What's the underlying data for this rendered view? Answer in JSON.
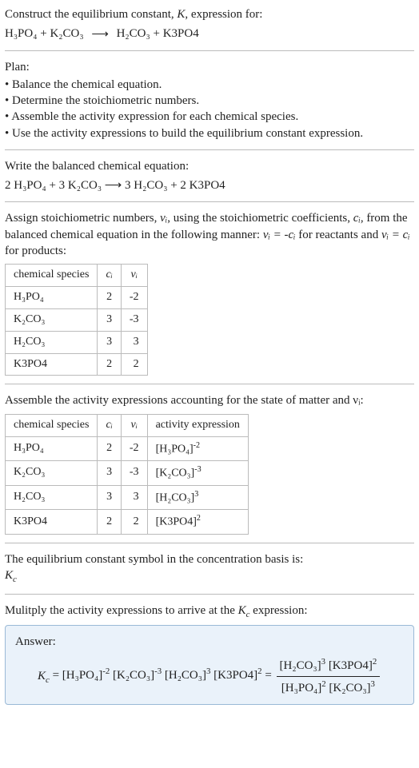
{
  "header": {
    "title_prefix": "Construct the equilibrium constant, ",
    "title_k": "K",
    "title_suffix": ", expression for:"
  },
  "main_eq": {
    "r1": "H₃PO₄",
    "plus1": " + ",
    "r2": "K₂CO₃",
    "arrow": "⟶",
    "p1": "H₂CO₃",
    "plus2": " + ",
    "p2": "K3PO4"
  },
  "plan": {
    "label": "Plan:",
    "items": [
      "Balance the chemical equation.",
      "Determine the stoichiometric numbers.",
      "Assemble the activity expression for each chemical species.",
      "Use the activity expressions to build the equilibrium constant expression."
    ]
  },
  "balanced": {
    "label": "Write the balanced chemical equation:",
    "text": "2 H₃PO₄ + 3 K₂CO₃  ⟶  3 H₂CO₃ + 2 K3PO4"
  },
  "assign_text": {
    "p1": "Assign stoichiometric numbers, ",
    "nu": "νᵢ",
    "p2": ", using the stoichiometric coefficients, ",
    "ci": "cᵢ",
    "p3": ", from the balanced chemical equation in the following manner: ",
    "eq1": "νᵢ = -cᵢ",
    "p4": " for reactants and ",
    "eq2": "νᵢ = cᵢ",
    "p5": " for products:"
  },
  "table1": {
    "h1": "chemical species",
    "h2": "cᵢ",
    "h3": "νᵢ",
    "rows": [
      {
        "sp": "H₃PO₄",
        "c": "2",
        "v": "-2"
      },
      {
        "sp": "K₂CO₃",
        "c": "3",
        "v": "-3"
      },
      {
        "sp": "H₂CO₃",
        "c": "3",
        "v": "3"
      },
      {
        "sp": "K3PO4",
        "c": "2",
        "v": "2"
      }
    ]
  },
  "assemble_label": "Assemble the activity expressions accounting for the state of matter and νᵢ:",
  "table2": {
    "h1": "chemical species",
    "h2": "cᵢ",
    "h3": "νᵢ",
    "h4": "activity expression",
    "rows": [
      {
        "sp": "H₃PO₄",
        "c": "2",
        "v": "-2",
        "ax_base": "[H₃PO₄]",
        "ax_exp": "-2"
      },
      {
        "sp": "K₂CO₃",
        "c": "3",
        "v": "-3",
        "ax_base": "[K₂CO₃]",
        "ax_exp": "-3"
      },
      {
        "sp": "H₂CO₃",
        "c": "3",
        "v": "3",
        "ax_base": "[H₂CO₃]",
        "ax_exp": "3"
      },
      {
        "sp": "K3PO4",
        "c": "2",
        "v": "2",
        "ax_base": "[K3PO4]",
        "ax_exp": "2"
      }
    ]
  },
  "eq_symbol": {
    "line": "The equilibrium constant symbol in the concentration basis is:",
    "kc": "K",
    "kc_sub": "c"
  },
  "multiply_label_a": "Mulitply the activity expressions to arrive at the ",
  "multiply_label_k": "K",
  "multiply_label_ks": "c",
  "multiply_label_b": " expression:",
  "answer": {
    "label": "Answer:",
    "lhs_k": "K",
    "lhs_ks": "c",
    "eq": " = ",
    "t1b": "[H₃PO₄]",
    "t1e": "-2",
    "t2b": "[K₂CO₃]",
    "t2e": "-3",
    "t3b": "[H₂CO₃]",
    "t3e": "3",
    "t4b": "[K3PO4]",
    "t4e": "2",
    "eq2": " = ",
    "num1b": "[H₂CO₃]",
    "num1e": "3",
    "num2b": "[K3PO4]",
    "num2e": "2",
    "den1b": "[H₃PO₄]",
    "den1e": "2",
    "den2b": "[K₂CO₃]",
    "den2e": "3"
  }
}
